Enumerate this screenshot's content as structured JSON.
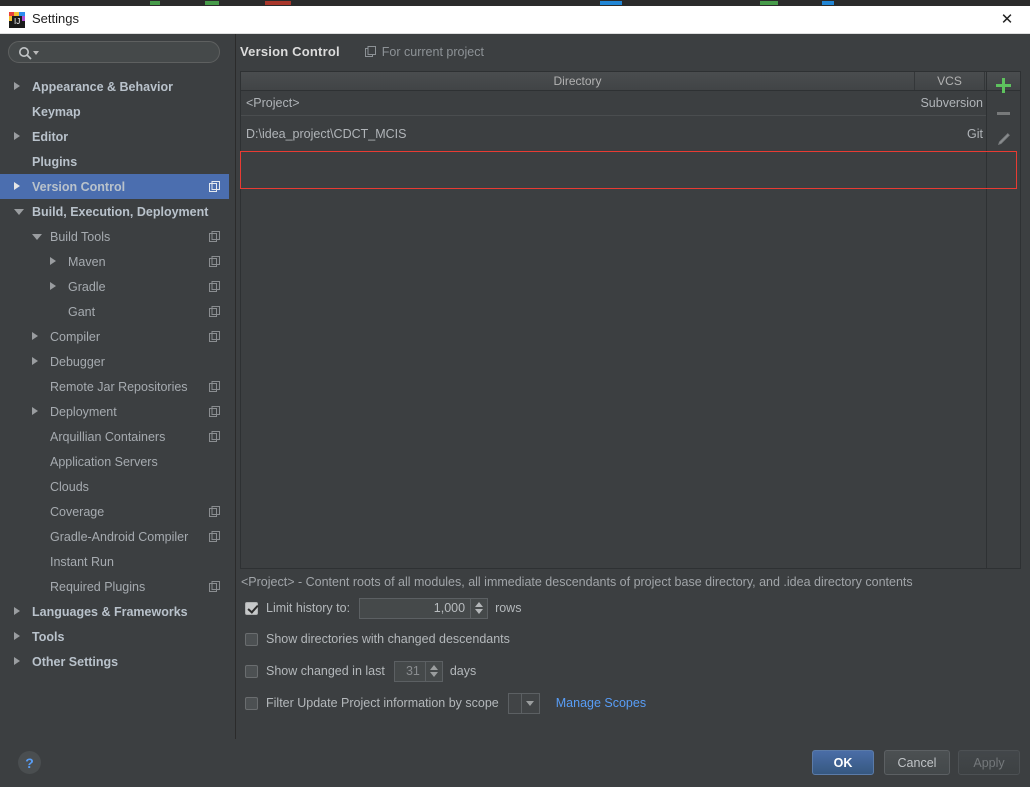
{
  "window": {
    "title": "Settings",
    "icon": "intellij-idea-icon",
    "close_label": "✕"
  },
  "sidebar": {
    "search": {
      "placeholder": "",
      "value": "",
      "icon": "search-icon"
    },
    "items": [
      {
        "label": "Appearance & Behavior",
        "level": 0,
        "twisty": "collapsed",
        "selected": false,
        "project_icon": false
      },
      {
        "label": "Keymap",
        "level": 0,
        "twisty": "none",
        "selected": false,
        "project_icon": false
      },
      {
        "label": "Editor",
        "level": 0,
        "twisty": "collapsed",
        "selected": false,
        "project_icon": false
      },
      {
        "label": "Plugins",
        "level": 0,
        "twisty": "none",
        "selected": false,
        "project_icon": false
      },
      {
        "label": "Version Control",
        "level": 0,
        "twisty": "collapsed",
        "selected": true,
        "project_icon": true
      },
      {
        "label": "Build, Execution, Deployment",
        "level": 0,
        "twisty": "expanded",
        "selected": false,
        "project_icon": false
      },
      {
        "label": "Build Tools",
        "level": 1,
        "twisty": "expanded",
        "selected": false,
        "project_icon": true
      },
      {
        "label": "Maven",
        "level": 2,
        "twisty": "collapsed",
        "selected": false,
        "project_icon": true
      },
      {
        "label": "Gradle",
        "level": 2,
        "twisty": "collapsed",
        "selected": false,
        "project_icon": true
      },
      {
        "label": "Gant",
        "level": 2,
        "twisty": "none",
        "selected": false,
        "project_icon": true
      },
      {
        "label": "Compiler",
        "level": 1,
        "twisty": "collapsed",
        "selected": false,
        "project_icon": true
      },
      {
        "label": "Debugger",
        "level": 1,
        "twisty": "collapsed",
        "selected": false,
        "project_icon": false
      },
      {
        "label": "Remote Jar Repositories",
        "level": 1,
        "twisty": "none",
        "selected": false,
        "project_icon": true
      },
      {
        "label": "Deployment",
        "level": 1,
        "twisty": "collapsed",
        "selected": false,
        "project_icon": true
      },
      {
        "label": "Arquillian Containers",
        "level": 1,
        "twisty": "none",
        "selected": false,
        "project_icon": true
      },
      {
        "label": "Application Servers",
        "level": 1,
        "twisty": "none",
        "selected": false,
        "project_icon": false
      },
      {
        "label": "Clouds",
        "level": 1,
        "twisty": "none",
        "selected": false,
        "project_icon": false
      },
      {
        "label": "Coverage",
        "level": 1,
        "twisty": "none",
        "selected": false,
        "project_icon": true
      },
      {
        "label": "Gradle-Android Compiler",
        "level": 1,
        "twisty": "none",
        "selected": false,
        "project_icon": true
      },
      {
        "label": "Instant Run",
        "level": 1,
        "twisty": "none",
        "selected": false,
        "project_icon": false
      },
      {
        "label": "Required Plugins",
        "level": 1,
        "twisty": "none",
        "selected": false,
        "project_icon": true
      },
      {
        "label": "Languages & Frameworks",
        "level": 0,
        "twisty": "collapsed",
        "selected": false,
        "project_icon": false
      },
      {
        "label": "Tools",
        "level": 0,
        "twisty": "collapsed",
        "selected": false,
        "project_icon": false
      },
      {
        "label": "Other Settings",
        "level": 0,
        "twisty": "collapsed",
        "selected": false,
        "project_icon": false
      }
    ]
  },
  "main": {
    "title": "Version Control",
    "scope_note": "For current project",
    "scope_icon": "project-scope-icon",
    "table": {
      "columns": [
        "Directory",
        "VCS"
      ],
      "rows": [
        {
          "directory": "<Project>",
          "vcs": "Subversion",
          "highlighted": false
        },
        {
          "directory": "D:\\idea_project\\CDCT_MCIS",
          "vcs": "Git",
          "highlighted": true
        }
      ],
      "toolbar": [
        {
          "name": "add-mapping-button",
          "icon": "plus-icon",
          "color": "#5ec25e"
        },
        {
          "name": "remove-mapping-button",
          "icon": "minus-icon",
          "color": "#77797a"
        },
        {
          "name": "edit-mapping-button",
          "icon": "pencil-icon",
          "color": "#8a8d8f"
        }
      ]
    },
    "hint": "<Project> - Content roots of all modules, all immediate descendants of project base directory, and .idea directory contents",
    "options": {
      "limit_history": {
        "label": "Limit history to:",
        "checked": true,
        "value": "1,000",
        "suffix": "rows"
      },
      "show_changed_descendants": {
        "label": "Show directories with changed descendants",
        "checked": false
      },
      "show_changed_in_last": {
        "label": "Show changed in last",
        "checked": false,
        "value": "31",
        "suffix": "days"
      },
      "filter_by_scope": {
        "label": "Filter Update Project information by scope",
        "checked": false,
        "value": "",
        "link": "Manage Scopes"
      }
    }
  },
  "footer": {
    "help_label": "?",
    "ok_label": "OK",
    "cancel_label": "Cancel",
    "apply_label": "Apply"
  },
  "colors": {
    "background": "#3c3f41",
    "selection": "#4b6eaf",
    "accent_link": "#589df6",
    "annotation": "#e83b33",
    "add_green": "#5ec25e"
  }
}
